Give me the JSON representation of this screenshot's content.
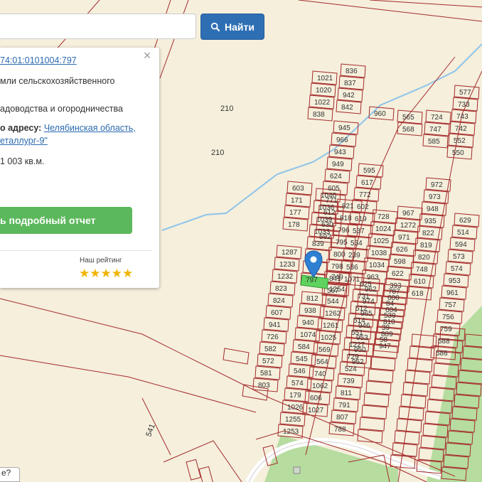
{
  "search": {
    "placeholder": "",
    "button_label": "Найти",
    "button_icon": "search-icon"
  },
  "popup": {
    "cad_number": "74:01:0101004:797",
    "category": "мли сельскохозяйственного",
    "usage": "адоводства и огородничества",
    "address_prefix": "о адресу:",
    "address_line1": "Челябинская область,",
    "address_line2": "еталлург-9\"",
    "area": "1 003 кв.м.",
    "report_button": "ь подробный отчет",
    "rating_label": "Наш рейтинг",
    "stars": "★★★★★",
    "close_icon": "close-icon"
  },
  "help_button": "е?",
  "colors": {
    "background": "#f5efdc",
    "parcel_stroke": "#a52b2b",
    "selected_parcel": "#5fd35f",
    "river": "#8ec4ea",
    "green_area": "#a8d890",
    "search_button": "#2e6fb4",
    "report_button": "#5cb85c",
    "marker": "#2f7fd3"
  },
  "map": {
    "large_labels": [
      "210",
      "210",
      "541"
    ],
    "parcel_labels": [
      "1021",
      "1020",
      "1022",
      "838",
      "836",
      "837",
      "942",
      "842",
      "960",
      "945",
      "966",
      "943",
      "949",
      "624",
      "605",
      "771",
      "612",
      "630",
      "592",
      "595",
      "617",
      "772",
      "602",
      "619",
      "537",
      "534",
      "239",
      "536",
      "1071",
      "603",
      "171",
      "177",
      "178",
      "1040",
      "1036",
      "1039",
      "1033",
      "839",
      "794",
      "793",
      "797",
      "821",
      "818",
      "796",
      "795",
      "800",
      "798",
      "841",
      "567",
      "565",
      "568",
      "724",
      "747",
      "585",
      "577",
      "733",
      "743",
      "742",
      "552",
      "550",
      "728",
      "1024",
      "1025",
      "1038",
      "1034",
      "963",
      "962",
      "974",
      "965",
      "946",
      "953",
      "950",
      "952",
      "967",
      "1272",
      "971",
      "626",
      "598",
      "622",
      "393",
      "600",
      "604",
      "810",
      "809",
      "947",
      "972",
      "973",
      "948",
      "935",
      "822",
      "819",
      "820",
      "748",
      "610",
      "618",
      "629",
      "514",
      "594",
      "573",
      "574",
      "953",
      "961",
      "757",
      "756",
      "759",
      "588",
      "586",
      "1287",
      "1233",
      "1232",
      "823",
      "824",
      "607",
      "941",
      "726",
      "582",
      "572",
      "581",
      "803",
      "812",
      "938",
      "940",
      "1074",
      "584",
      "545",
      "546",
      "574",
      "179",
      "1026",
      "1255",
      "1253",
      "749",
      "1254",
      "544",
      "1262",
      "1261",
      "1025",
      "569",
      "564",
      "740",
      "1062",
      "606",
      "1027",
      "625",
      "731",
      "512",
      "514",
      "551",
      "1227",
      "729",
      "524",
      "739",
      "811",
      "791",
      "807",
      "788",
      "787",
      "84",
      "539",
      "39",
      "58"
    ]
  }
}
